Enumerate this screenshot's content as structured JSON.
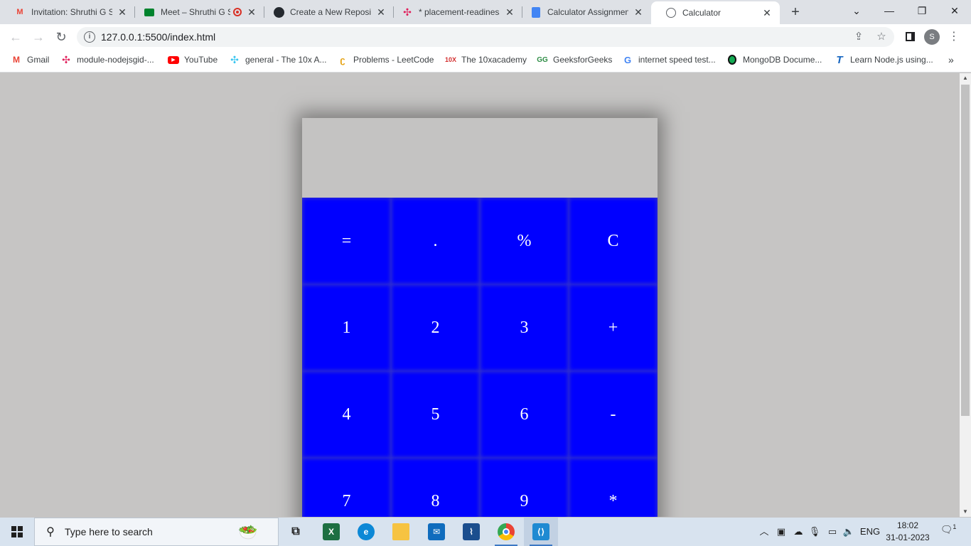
{
  "browser": {
    "tabs": [
      {
        "title": "Invitation: Shruthi G S",
        "icon": "gmail-icon",
        "active": false
      },
      {
        "title": "Meet – Shruthi G S",
        "icon": "meet-icon",
        "active": false
      },
      {
        "title": "Create a New Reposito",
        "icon": "github-icon",
        "active": false
      },
      {
        "title": "* placement-readiness",
        "icon": "slack-icon",
        "active": false
      },
      {
        "title": "Calculator Assignment",
        "icon": "docs-icon",
        "active": false
      },
      {
        "title": "Calculator",
        "icon": "globe-icon",
        "active": true
      }
    ],
    "new_tab_label": "+",
    "window_controls": {
      "tab_search": "⌄",
      "minimize": "—",
      "restore": "❐",
      "close": "✕"
    },
    "address_bar": {
      "url": "127.0.0.1:5500/index.html"
    },
    "avatar_letter": "S",
    "bookmarks": [
      {
        "label": "Gmail",
        "icon": "gmail-icon"
      },
      {
        "label": "module-nodejsgid-...",
        "icon": "slack-icon"
      },
      {
        "label": "YouTube",
        "icon": "youtube-icon"
      },
      {
        "label": "general - The 10x A...",
        "icon": "slack-icon"
      },
      {
        "label": "Problems - LeetCode",
        "icon": "leetcode-icon"
      },
      {
        "label": "The 10xacademy",
        "icon": "tenx-icon"
      },
      {
        "label": "GeeksforGeeks",
        "icon": "gfg-icon"
      },
      {
        "label": "internet speed test...",
        "icon": "google-icon"
      },
      {
        "label": "MongoDB Docume...",
        "icon": "mongodb-icon"
      },
      {
        "label": "Learn Node.js using...",
        "icon": "typescript-icon"
      }
    ],
    "bookmarks_overflow": "»"
  },
  "calculator": {
    "display_value": "",
    "keys": [
      "=",
      ".",
      "%",
      "C",
      "1",
      "2",
      "3",
      "+",
      "4",
      "5",
      "6",
      "-",
      "7",
      "8",
      "9",
      "*"
    ],
    "colors": {
      "key_background": "#0000ff",
      "key_text": "#ffffff",
      "display_background": "#c4c3c2",
      "page_background": "#c6c5c4"
    }
  },
  "taskbar": {
    "search_placeholder": "Type here to search",
    "apps": [
      "task-view",
      "excel",
      "edge",
      "file-explorer",
      "mail",
      "wireshark",
      "chrome",
      "vscode"
    ],
    "language": "ENG",
    "time": "18:02",
    "date": "31-01-2023",
    "notification_count": "1"
  }
}
